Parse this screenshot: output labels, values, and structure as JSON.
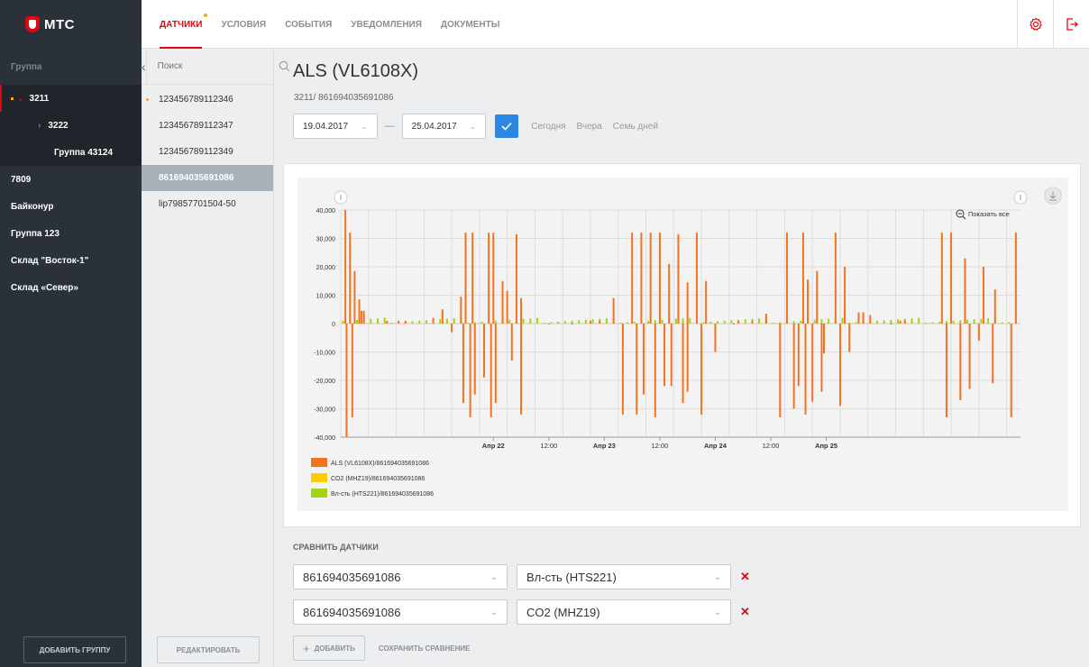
{
  "app": {
    "logo": "МТС"
  },
  "nav": {
    "tabs": [
      "ДАТЧИКИ",
      "УСЛОВИЯ",
      "СОБЫТИЯ",
      "УВЕДОМЛЕНИЯ",
      "ДОКУМЕНТЫ"
    ],
    "active_index": 0
  },
  "top_icons": [
    "gear-icon",
    "logout-icon"
  ],
  "sidebar": {
    "header": "Группа",
    "items": [
      {
        "label": "3211",
        "level": 0,
        "selected": true,
        "expanded": true
      },
      {
        "label": "3222",
        "level": 1,
        "collapsed": true
      },
      {
        "label": "Группа 43124",
        "level": 2
      },
      {
        "label": "7809",
        "level": 0
      },
      {
        "label": "Байконур",
        "level": 0
      },
      {
        "label": "Группа 123",
        "level": 0
      },
      {
        "label": "Склад \"Восток-1\"",
        "level": 0
      },
      {
        "label": "Склад «Север»",
        "level": 0
      }
    ],
    "add_group_button": "ДОБАВИТЬ ГРУППУ"
  },
  "device_list": {
    "search_placeholder": "Поиск",
    "items": [
      {
        "label": "123456789112346",
        "marked": true
      },
      {
        "label": "123456789112347"
      },
      {
        "label": "123456789112349"
      },
      {
        "label": "861694035691086",
        "active": true
      },
      {
        "label": "lip79857701504-50"
      }
    ],
    "edit_button": "РЕДАКТИРОВАТЬ"
  },
  "main": {
    "title": "ALS (VL6108X)",
    "subtitle": "3211/ 861694035691086",
    "date_from": "19.04.2017",
    "date_to": "25.04.2017",
    "quick_ranges": [
      "Сегодня",
      "Вчера",
      "Семь дней"
    ],
    "show_all": "Показать все"
  },
  "chart_data": {
    "type": "bar",
    "x_ticks": [
      "Апр 22",
      "12:00",
      "Апр 23",
      "12:00",
      "Апр 24",
      "12:00",
      "Апр 25"
    ],
    "y_ticks": [
      "40,000",
      "30,000",
      "20,000",
      "10,000",
      "0",
      "-10,000",
      "-20,000",
      "-30,000",
      "-40,000"
    ],
    "ylim": [
      -40000,
      40000
    ],
    "grid": true,
    "legend_position": "bottom-left",
    "series": [
      {
        "name": "ALS (VL6108X)/861694035691086",
        "color": "#f5721f",
        "values": [
          40000,
          -40000,
          32000,
          -33000,
          18500,
          8500,
          4500,
          4500,
          1000,
          1000,
          1000,
          2000,
          5000,
          -3000,
          9500,
          -28000,
          32000,
          -33000,
          32000,
          -25000,
          -19000,
          32000,
          -33000,
          32000,
          -28000,
          15000,
          11500,
          -13000,
          31500,
          -32000,
          9000,
          0,
          0,
          1000,
          1000,
          9000,
          -32000,
          32000,
          -32000,
          32000,
          -25000,
          32000,
          -33000,
          32000,
          -22000,
          21000,
          -22000,
          31500,
          -28000,
          14500,
          -24000,
          32000,
          -32000,
          15000,
          -10000,
          0,
          1000,
          1000,
          3500,
          -33000,
          32000,
          -30000,
          -22000,
          32000,
          -32000,
          15500,
          -27500,
          18500,
          -24000,
          -10500,
          32000,
          -29000,
          20000,
          5000,
          -10000,
          4000,
          4000,
          3000,
          0,
          1000,
          1000,
          32000,
          -33000,
          32000,
          -27000,
          23000,
          -23000,
          -6000,
          20000,
          -21000,
          12000,
          -33000,
          32000
        ],
        "x_hours": [
          2,
          2.5,
          4,
          5,
          6,
          8,
          9,
          10,
          20,
          25,
          28,
          40,
          44,
          48,
          52,
          53,
          54,
          56,
          57,
          58,
          62,
          64,
          65,
          66,
          67,
          70,
          72,
          74,
          76,
          78,
          78,
          90,
          100,
          108,
          112,
          118,
          122,
          126,
          128,
          130,
          131,
          134,
          136,
          138,
          140,
          142,
          143,
          146,
          148,
          150,
          150,
          154,
          156,
          158,
          162,
          170,
          172,
          178,
          184,
          190,
          193,
          196,
          198,
          200,
          201,
          202,
          204,
          206,
          208,
          209,
          214,
          216,
          218,
          218,
          220,
          224,
          226,
          229,
          238,
          242,
          244,
          260,
          262,
          264,
          268,
          270,
          272,
          276,
          278,
          282,
          283,
          290,
          292
        ]
      },
      {
        "name": "CO2 (MHZ19)/861694035691086",
        "color": "#ffcc00",
        "values": []
      },
      {
        "name": "Вл-сть (HTS221)/861694035691086",
        "color": "#a2d317",
        "values": []
      }
    ]
  },
  "compare": {
    "label": "СРАВНИТЬ ДАТЧИКИ",
    "rows": [
      {
        "device": "861694035691086",
        "sensor": "Вл-сть (HTS221)"
      },
      {
        "device": "861694035691086",
        "sensor": "CO2 (MHZ19)"
      }
    ],
    "add_button": "ДОБАВИТЬ",
    "save_link": "СОХРАНИТЬ СРАВНЕНИЕ"
  }
}
